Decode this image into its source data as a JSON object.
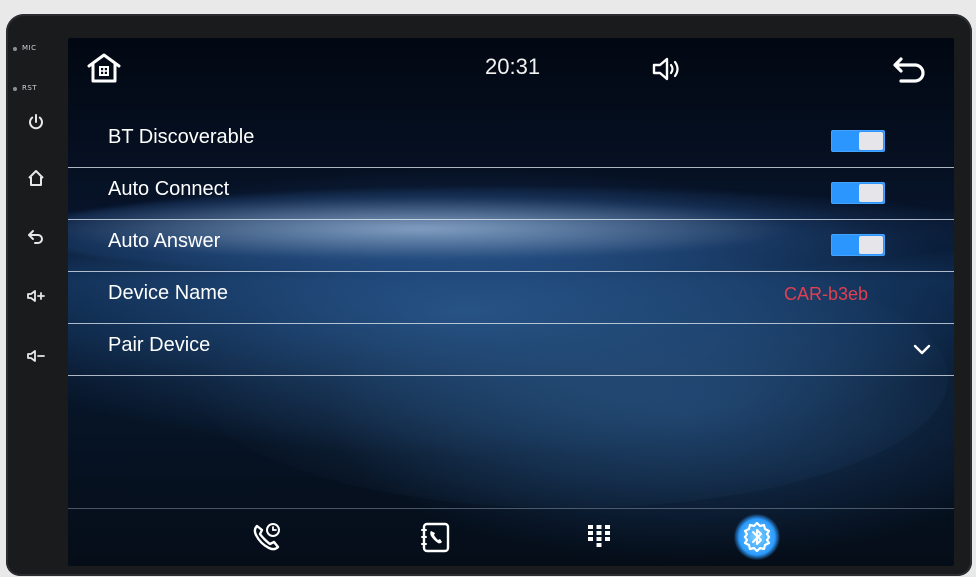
{
  "status_bar": {
    "time": "20:31"
  },
  "side_panel": {
    "mic_label": "MIC",
    "rst_label": "RST"
  },
  "settings": {
    "rows": [
      {
        "label": "BT Discoverable",
        "control": "toggle",
        "on": true
      },
      {
        "label": "Auto Connect",
        "control": "toggle",
        "on": true
      },
      {
        "label": "Auto Answer",
        "control": "toggle",
        "on": true
      },
      {
        "label": "Device Name",
        "value": "CAR-b3eb"
      },
      {
        "label": "Pair Device",
        "control": "expand"
      }
    ]
  },
  "colors": {
    "accent": "#2c96ff",
    "device_name": "#e04050"
  },
  "icons": {
    "top": [
      "home-icon",
      "volume-icon",
      "back-icon"
    ],
    "dock": [
      "call-log-icon",
      "contacts-icon",
      "dialpad-icon",
      "bluetooth-settings-icon"
    ],
    "side": [
      "power-icon",
      "home-icon",
      "back-icon",
      "volume-up-icon",
      "volume-down-icon"
    ]
  }
}
